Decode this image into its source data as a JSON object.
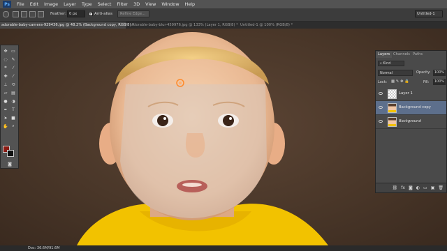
{
  "app": {
    "logo": "Ps"
  },
  "menu": [
    "File",
    "Edit",
    "Image",
    "Layer",
    "Type",
    "Select",
    "Filter",
    "3D",
    "View",
    "Window",
    "Help"
  ],
  "options": {
    "feather_label": "Feather:",
    "feather_value": "0 px",
    "antialias_label": "Anti-alias",
    "refine_label": "Refine Edge...",
    "workspace": "Untitled-1"
  },
  "tabs": [
    "adorable-baby-camera-929436.jpg @ 48.2% (Background copy, RGB/8) *",
    "adorable-baby-blur-459976.jpg @ 133% (Layer 1, RGB/8) *",
    "Untitled-1 @ 100% (RGB/8) *"
  ],
  "layers_panel": {
    "tabs": [
      "Layers",
      "Channels",
      "Paths"
    ],
    "kind": "Kind",
    "blend_mode": "Normal",
    "opacity_label": "Opacity:",
    "opacity_value": "100%",
    "lock_label": "Lock:",
    "fill_label": "Fill:",
    "fill_value": "100%",
    "layers": [
      {
        "name": "Layer 1"
      },
      {
        "name": "Background copy"
      },
      {
        "name": "Background"
      }
    ],
    "footer_icons": [
      "link-icon",
      "fx-icon",
      "mask-icon",
      "adjustment-icon",
      "folder-icon",
      "new-layer-icon",
      "trash-icon"
    ]
  },
  "status": {
    "doc": "Doc: 36.6M/91.6M"
  },
  "colors": {
    "foreground": "#8b1a12",
    "background": "#111111",
    "selected_layer": "#5d6f8c",
    "skin": "#f2c7a3",
    "shirt": "#f2c200"
  }
}
